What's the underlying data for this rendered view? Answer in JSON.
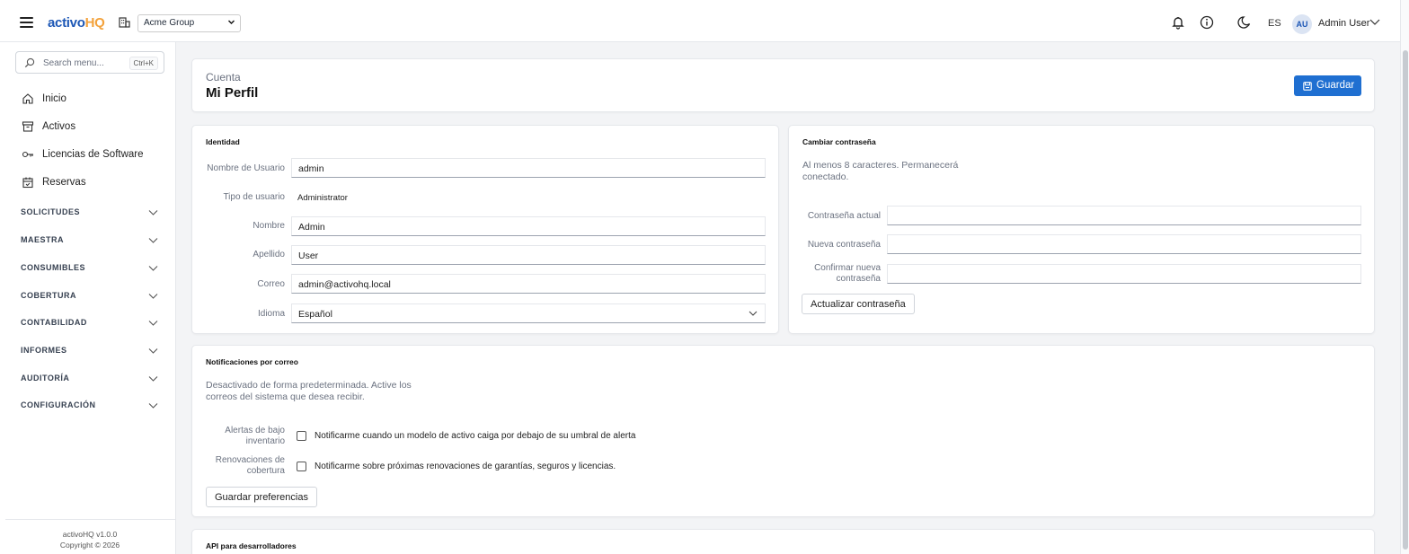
{
  "topbar": {
    "logo_part1": "activo",
    "logo_part2": "HQ",
    "org_selected": "Acme Group",
    "lang": "ES",
    "avatar_initials": "AU",
    "user_name": "Admin User"
  },
  "sidebar": {
    "search_placeholder": "Search menu...",
    "search_shortcut": "Ctrl+K",
    "items": [
      {
        "label": "Inicio",
        "icon": "home-icon"
      },
      {
        "label": "Activos",
        "icon": "archive-icon"
      },
      {
        "label": "Licencias de Software",
        "icon": "key-icon"
      },
      {
        "label": "Reservas",
        "icon": "calendar-icon"
      }
    ],
    "sections": [
      {
        "label": "SOLICITUDES"
      },
      {
        "label": "MAESTRA"
      },
      {
        "label": "CONSUMIBLES"
      },
      {
        "label": "COBERTURA"
      },
      {
        "label": "CONTABILIDAD"
      },
      {
        "label": "INFORMES"
      },
      {
        "label": "AUDITORÍA"
      },
      {
        "label": "CONFIGURACIÓN"
      }
    ],
    "version": "activoHQ v1.0.0",
    "copyright": "Copyright © 2026"
  },
  "page": {
    "breadcrumb": "Cuenta",
    "title": "Mi Perfil",
    "save_label": "Guardar"
  },
  "identity": {
    "title": "Identidad",
    "username_label": "Nombre de Usuario",
    "username_value": "admin",
    "usertype_label": "Tipo de usuario",
    "usertype_value": "Administrator",
    "firstname_label": "Nombre",
    "firstname_value": "Admin",
    "lastname_label": "Apellido",
    "lastname_value": "User",
    "email_label": "Correo",
    "email_value": "admin@activohq.local",
    "language_label": "Idioma",
    "language_value": "Español"
  },
  "password": {
    "title": "Cambiar contraseña",
    "hint": "Al menos 8 caracteres. Permanecerá conectado.",
    "current_label": "Contraseña actual",
    "new_label": "Nueva contraseña",
    "confirm_label": "Confirmar nueva contraseña",
    "update_label": "Actualizar contraseña"
  },
  "notifications": {
    "title": "Notificaciones por correo",
    "hint": "Desactivado de forma predeterminada. Active los correos del sistema que desea recibir.",
    "low_stock_label": "Alertas de bajo inventario",
    "low_stock_text": "Notificarme cuando un modelo de activo caiga por debajo de su umbral de alerta",
    "coverage_label": "Renovaciones de cobertura",
    "coverage_text": "Notificarme sobre próximas renovaciones de garantías, seguros y licencias.",
    "save_label": "Guardar preferencias"
  },
  "api": {
    "title": "API para desarrolladores"
  },
  "colors": {
    "brand_blue": "#1e58b6",
    "brand_orange": "#f3a23c",
    "primary_button": "#1f6fd1"
  }
}
